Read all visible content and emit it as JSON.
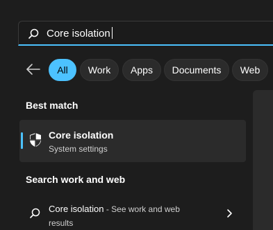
{
  "search": {
    "value": "Core isolation"
  },
  "filters": [
    {
      "label": "All",
      "active": true
    },
    {
      "label": "Work"
    },
    {
      "label": "Apps"
    },
    {
      "label": "Documents"
    },
    {
      "label": "Web"
    }
  ],
  "best_match": {
    "heading": "Best match",
    "name": "Core isolation",
    "subtitle": "System settings"
  },
  "search_web": {
    "heading": "Search work and web",
    "query": "Core isolation",
    "suffix": " - See work and web results"
  },
  "colors": {
    "accent": "#4cc2ff",
    "background": "#1d1d1d",
    "card": "#2b2b2b"
  }
}
